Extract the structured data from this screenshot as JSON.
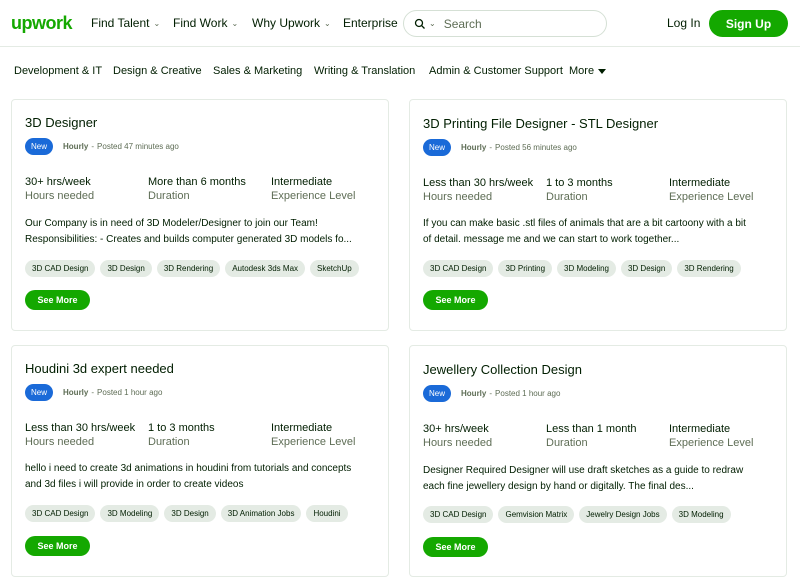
{
  "header": {
    "logo": "upwork",
    "nav": [
      "Find Talent",
      "Find Work",
      "Why Upwork",
      "Enterprise"
    ],
    "search_placeholder": "Search",
    "login": "Log In",
    "signup": "Sign Up"
  },
  "categories": [
    "Development & IT",
    "Design & Creative",
    "Sales & Marketing",
    "Writing & Translation",
    "Admin & Customer Support"
  ],
  "more_label": "More",
  "stat_labels": {
    "hours": "Hours needed",
    "duration": "Duration",
    "level": "Experience Level"
  },
  "see_more_label": "See More",
  "jobs": [
    {
      "title": "3D Designer",
      "badge": "New",
      "rate": "Hourly",
      "posted": "Posted 47 minutes ago",
      "hours": "30+ hrs/week",
      "duration": "More than 6 months",
      "level": "Intermediate",
      "desc1": "Our Company is in need of 3D Modeler/Designer to join our Team!",
      "desc2": "Responsibilities: - Creates and builds computer generated 3D models fo...",
      "tags": [
        "3D CAD Design",
        "3D Design",
        "3D Rendering",
        "Autodesk 3ds Max",
        "SketchUp"
      ]
    },
    {
      "title": "3D Printing File Designer - STL Designer",
      "badge": "New",
      "rate": "Hourly",
      "posted": "Posted 56 minutes ago",
      "hours": "Less than 30 hrs/week",
      "duration": "1 to 3 months",
      "level": "Intermediate",
      "desc1": "If you can make basic .stl files of animals that are a bit cartoony with a bit",
      "desc2": "of detail. message me and we can start to work together...",
      "tags": [
        "3D CAD Design",
        "3D Printing",
        "3D Modeling",
        "3D Design",
        "3D Rendering"
      ]
    },
    {
      "title": "Houdini 3d expert needed",
      "badge": "New",
      "rate": "Hourly",
      "posted": "Posted 1 hour ago",
      "hours": "Less than 30 hrs/week",
      "duration": "1 to 3 months",
      "level": "Intermediate",
      "desc1": "hello i need to create 3d animations in houdini from tutorials and concepts",
      "desc2": "and 3d files i will provide in order to create videos",
      "tags": [
        "3D CAD Design",
        "3D Modeling",
        "3D Design",
        "3D Animation Jobs",
        "Houdini"
      ]
    },
    {
      "title": "Jewellery Collection Design",
      "badge": "New",
      "rate": "Hourly",
      "posted": "Posted 1 hour ago",
      "hours": "30+ hrs/week",
      "duration": "Less than 1 month",
      "level": "Intermediate",
      "desc1": "Designer Required Designer will use draft sketches as a guide to redraw",
      "desc2": "each fine jewellery design by hand or digitally. The final des...",
      "tags": [
        "3D CAD Design",
        "Gemvision Matrix",
        "Jewelry Design Jobs",
        "3D Modeling"
      ]
    }
  ]
}
